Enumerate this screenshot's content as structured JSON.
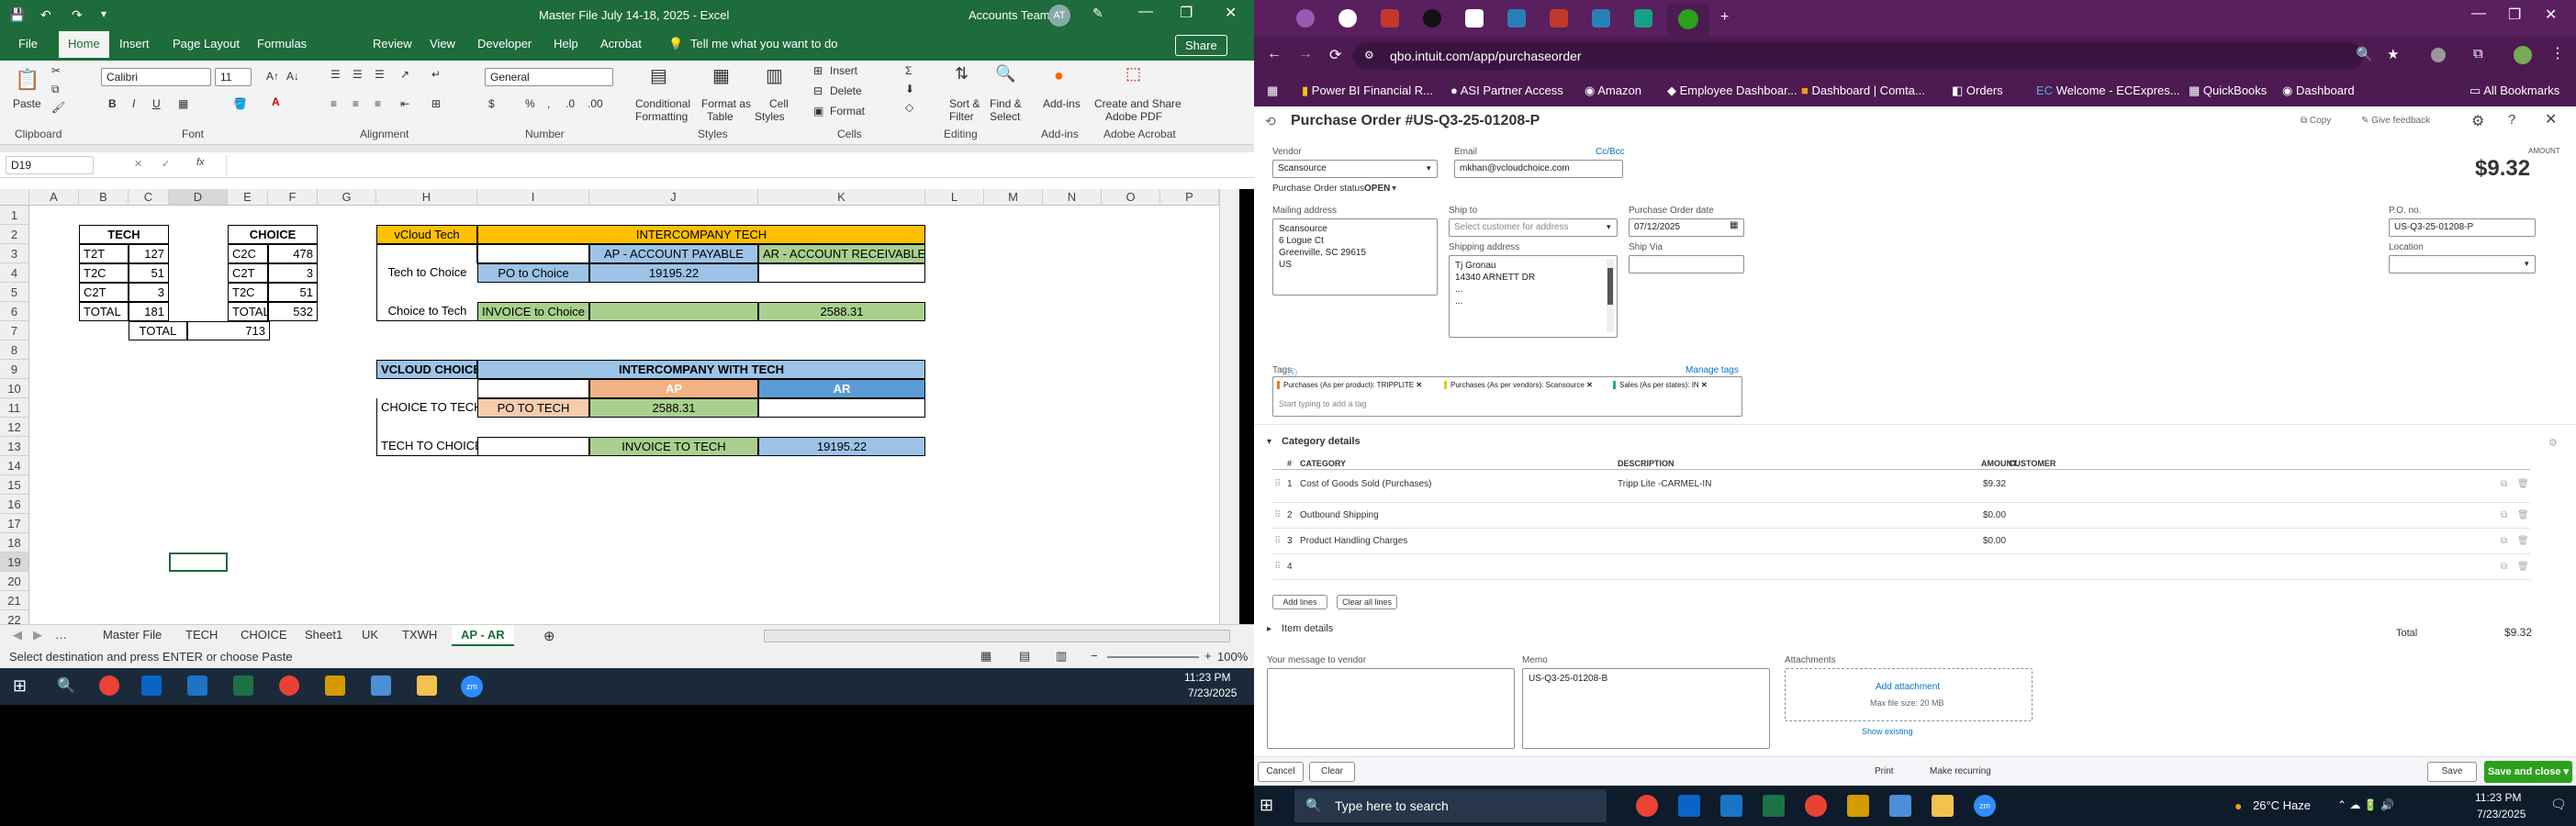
{
  "excel": {
    "title": "Master File July 14-18, 2025  -  Excel",
    "account": "Accounts Team",
    "avatar": "AT",
    "tabs": [
      "File",
      "Home",
      "Insert",
      "Page Layout",
      "Formulas",
      "Review",
      "View",
      "Developer",
      "Help",
      "Acrobat"
    ],
    "tellme": "Tell me what you want to do",
    "share": "Share",
    "ribbon": {
      "paste": "Paste",
      "clipboard": "Clipboard",
      "font_name": "Calibri",
      "font_size": "11",
      "font": "Font",
      "alignment": "Alignment",
      "number_format": "General",
      "number": "Number",
      "conditional": "Conditional",
      "formatting": "Formatting",
      "format_as": "Format as",
      "table": "Table",
      "cell": "Cell",
      "styles_btn": "Styles",
      "styles": "Styles",
      "insert": "Insert",
      "delete": "Delete",
      "format": "Format",
      "cells": "Cells",
      "sort_filter": "Sort &",
      "filter": "Filter",
      "find_select": "Find &",
      "select": "Select",
      "editing": "Editing",
      "addins": "Add-ins",
      "addins_grp": "Add-ins",
      "create_share": "Create and Share",
      "adobe_pdf": "Adobe PDF",
      "adobe_grp": "Adobe Acrobat"
    },
    "namebox": "D19",
    "fx": "fx",
    "columns": [
      "A",
      "B",
      "C",
      "D",
      "E",
      "F",
      "G",
      "H",
      "I",
      "J",
      "K",
      "L",
      "M",
      "N",
      "O",
      "P"
    ],
    "rows": [
      "1",
      "2",
      "3",
      "4",
      "5",
      "6",
      "7",
      "8",
      "9",
      "10",
      "11",
      "12",
      "13",
      "14",
      "15",
      "16",
      "17",
      "18",
      "19",
      "20",
      "21",
      "22"
    ],
    "cells": {
      "tech_hdr": "TECH",
      "t2t": "T2T",
      "t2t_v": "127",
      "t2c": "T2C",
      "t2c_v": "51",
      "c2t": "C2T",
      "c2t_v": "3",
      "total": "TOTAL",
      "total_v": "181",
      "choice_hdr": "CHOICE",
      "c2c": "C2C",
      "c2c_v": "478",
      "c2t2": "C2T",
      "c2t2_v": "3",
      "t2c2": "T2C",
      "t2c2_v": "51",
      "total2": "TOTAL",
      "total2_v": "532",
      "grand": "TOTAL",
      "grand_v": "713",
      "vcloud_tech": "vCloud Tech",
      "interco": "INTERCOMPANY TECH",
      "ap_payable": "AP - ACCOUNT PAYABLE",
      "ar_receivable": "AR - ACCOUNT RECEIVABLE",
      "tech_to_choice": "Tech to Choice",
      "po_to_choice": "PO to Choice",
      "po_val": "19195.22",
      "choice_to_tech": "Choice to Tech",
      "invoice_to_choice": "INVOICE to Choice",
      "inv_val": "2588.31",
      "vcloud_choice": "VCLOUD CHOICE",
      "interco_tech": "INTERCOMPANY WITH TECH",
      "ap": "AP",
      "ar": "AR",
      "choice_to_tech2": "CHOICE TO TECH",
      "po_to_tech": "PO TO TECH",
      "po2_val": "2588.31",
      "tech_to_choice2": "TECH TO CHOICE",
      "invoice_to_tech": "INVOICE TO TECH",
      "inv2_val": "19195.22"
    },
    "sheets": [
      "Master File",
      "TECH",
      "CHOICE",
      "Sheet1",
      "UK",
      "TXWH",
      "AP - AR"
    ],
    "status": "Select destination and press ENTER or choose Paste",
    "zoom": "100%",
    "time": "11:23 PM",
    "date": "7/23/2025"
  },
  "chrome": {
    "url": "qbo.intuit.com/app/purchaseorder",
    "bookmarks": [
      "Power BI Financial R...",
      "ASI Partner Access",
      "Amazon",
      "Employee Dashboar...",
      "Dashboard | Comta...",
      "Orders",
      "Welcome - ECExpres...",
      "QuickBooks",
      "Dashboard",
      "All Bookmarks"
    ]
  },
  "qbo": {
    "title": "Purchase Order #US-Q3-25-01208-P",
    "copy": "Copy",
    "feedback": "Give feedback",
    "vendor_lbl": "Vendor",
    "vendor": "Scansource",
    "email_lbl": "Email",
    "ccbcc": "Cc/Bcc",
    "email": "mkhan@vcloudchoice.com",
    "status_lbl": "Purchase Order status",
    "status": "OPEN",
    "amount_lbl": "AMOUNT",
    "amount": "$9.32",
    "mailing_lbl": "Mailing address",
    "mailing": [
      "Scansource",
      "6 Logue Ct",
      "Greenville, SC 29615",
      "US"
    ],
    "shipto_lbl": "Ship to",
    "shipto_ph": "Select customer for address",
    "shipping_lbl": "Shipping address",
    "shipping": [
      "Tj Gronau",
      "14340 ARNETT DR",
      "...",
      "..."
    ],
    "podate_lbl": "Purchase Order date",
    "podate": "07/12/2025",
    "shipvia_lbl": "Ship Via",
    "pono_lbl": "P.O. no.",
    "pono": "US-Q3-25-01208-P",
    "location_lbl": "Location",
    "tags_lbl": "Tags",
    "manage_tags": "Manage tags",
    "tags": [
      "Purchases (As per product): TRIPPLITE",
      "Purchases (As per vendors): Scansource",
      "Sales (As per states): IN"
    ],
    "tag_ph": "Start typing to add a tag",
    "category_details": "Category details",
    "cols": [
      "#",
      "CATEGORY",
      "DESCRIPTION",
      "AMOUNT",
      "CUSTOMER"
    ],
    "lines": [
      {
        "n": "1",
        "cat": "Cost of Goods Sold (Purchases)",
        "desc": "Tripp Lite -CARMEL-IN",
        "amt": "$9.32"
      },
      {
        "n": "2",
        "cat": "Outbound Shipping",
        "desc": "",
        "amt": "$0.00"
      },
      {
        "n": "3",
        "cat": "Product Handling Charges",
        "desc": "",
        "amt": "$0.00"
      },
      {
        "n": "4",
        "cat": "",
        "desc": "",
        "amt": ""
      }
    ],
    "add_lines": "Add lines",
    "clear_lines": "Clear all lines",
    "item_details": "Item details",
    "total_lbl": "Total",
    "total": "$9.32",
    "msg_lbl": "Your message to vendor",
    "memo_lbl": "Memo",
    "memo": "US-Q3-25-01208-B",
    "attach_lbl": "Attachments",
    "add_attach": "Add attachment",
    "max_size": "Max file size: 20 MB",
    "show_existing": "Show existing",
    "cancel": "Cancel",
    "clear": "Clear",
    "print": "Print",
    "recurring": "Make recurring",
    "save": "Save",
    "save_close": "Save and close"
  },
  "taskbar": {
    "search": "Type here to search",
    "weather": "26°C  Haze",
    "time": "11:23 PM",
    "date": "7/23/2025"
  }
}
